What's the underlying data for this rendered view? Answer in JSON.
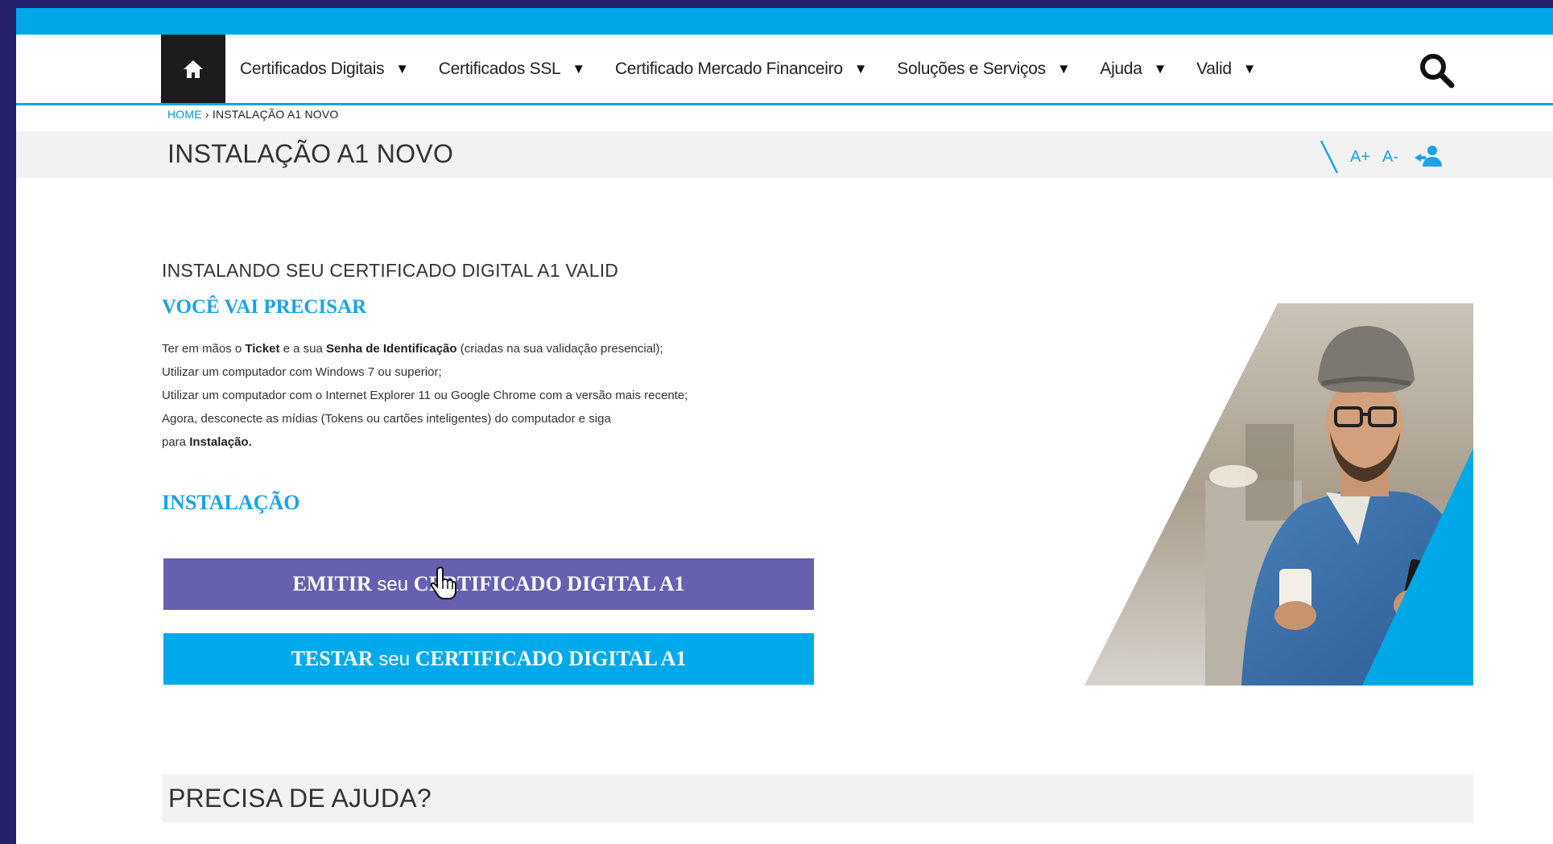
{
  "nav": {
    "items": [
      {
        "label": "Certificados Digitais"
      },
      {
        "label": "Certificados SSL"
      },
      {
        "label": "Certificado Mercado Financeiro"
      },
      {
        "label": "Soluções e Serviços"
      },
      {
        "label": "Ajuda"
      },
      {
        "label": "Valid"
      }
    ],
    "caret": "▼"
  },
  "breadcrumb": {
    "home": "HOME",
    "separator": " › ",
    "current": "INSTALAÇÃO A1 NOVO"
  },
  "page": {
    "title": "INSTALAÇÃO A1 NOVO",
    "font_increase": "A+",
    "font_decrease": "A-"
  },
  "content": {
    "section_heading": "INSTALANDO SEU CERTIFICADO DIGITAL A1 VALID",
    "need_heading": "VOCÊ VAI PRECISAR",
    "requirements": {
      "line1_a": "Ter em mãos o ",
      "line1_b": "Ticket",
      "line1_c": " e a sua ",
      "line1_d": "Senha de Identificação",
      "line1_e": " (criadas na sua validação presencial);",
      "line2": "Utilizar um computador com Windows 7 ou superior;",
      "line3": "Utilizar um computador com o Internet Explorer 11 ou Google Chrome com a versão mais recente;",
      "line4": "Agora, desconecte as mídias (Tokens ou cartões inteligentes) do computador e siga",
      "line5_a": "para ",
      "line5_b": "Instalação."
    },
    "install_heading": "INSTALAÇÃO",
    "emit_button": {
      "a": "EMITIR",
      "b": " seu ",
      "c": "CERTIFICADO DIGITAL A1"
    },
    "test_button": {
      "a": "TESTAR",
      "b": " seu ",
      "c": "CERTIFICADO DIGITAL A1"
    }
  },
  "help": {
    "title": "PRECISA DE AJUDA?"
  },
  "colors": {
    "accent": "#00a8e8",
    "emit_button": "#6660b0",
    "test_button": "#00aaea",
    "heading_blue": "#1aa3e6"
  }
}
